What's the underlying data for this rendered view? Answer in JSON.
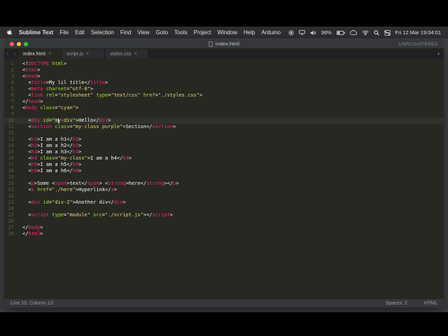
{
  "menubar": {
    "items": [
      "Sublime Text",
      "File",
      "Edit",
      "Selection",
      "Find",
      "View",
      "Goto",
      "Tools",
      "Project",
      "Window",
      "Help",
      "Arduino"
    ],
    "status_items": [
      {
        "type": "icon",
        "name": "screen-record-icon"
      },
      {
        "type": "icon",
        "name": "display-icon"
      },
      {
        "type": "icon",
        "name": "volume-icon"
      },
      {
        "type": "text",
        "name": "battery-percentage",
        "value": "36%"
      },
      {
        "type": "icon",
        "name": "battery-icon"
      },
      {
        "type": "icon",
        "name": "cloud-icon"
      },
      {
        "type": "icon",
        "name": "wifi-icon"
      },
      {
        "type": "icon",
        "name": "search-icon"
      },
      {
        "type": "icon",
        "name": "control-center-icon"
      },
      {
        "type": "text",
        "name": "menubar-clock",
        "value": "Fri 12 Mar 19:04:01"
      }
    ]
  },
  "window": {
    "title": "index.html",
    "registration_status": "UNREGISTERED",
    "tabs": [
      {
        "label": "index.html",
        "active": true
      },
      {
        "label": "script.js",
        "active": false
      },
      {
        "label": "styles.css",
        "active": false
      }
    ],
    "close_glyph": "×",
    "tab_scroll_left": "‹",
    "tab_scroll_right": "›",
    "tab_overflow_glyph": "▾"
  },
  "statusbar": {
    "position": "Line 10, Column 13",
    "indentation": "Spaces: 2",
    "syntax": "HTML"
  },
  "editor": {
    "current_line": 10,
    "caret_column": 13,
    "colors": {
      "tag": "#f92672",
      "attr": "#a6e22e",
      "string": "#e6db74",
      "text": "#f8f8f2",
      "punct": "#f8f8f2",
      "line_number": "#5b5d50",
      "background": "#272822"
    },
    "lines": [
      [
        [
          "w",
          "<!"
        ],
        [
          "t",
          "DOCTYPE"
        ],
        [
          "a",
          " html"
        ],
        [
          "w",
          ">"
        ]
      ],
      [
        [
          "w",
          "<"
        ],
        [
          "t",
          "html"
        ],
        [
          "w",
          ">"
        ]
      ],
      [
        [
          "w",
          "<"
        ],
        [
          "t",
          "head"
        ],
        [
          "w",
          ">"
        ]
      ],
      [
        [
          "w",
          "  <"
        ],
        [
          "t",
          "title"
        ],
        [
          "w",
          ">"
        ],
        [
          "x",
          "My lil title"
        ],
        [
          "w",
          "</"
        ],
        [
          "t",
          "title"
        ],
        [
          "w",
          ">"
        ]
      ],
      [
        [
          "w",
          "  <"
        ],
        [
          "t",
          "meta"
        ],
        [
          "a",
          " charset"
        ],
        [
          "w",
          "="
        ],
        [
          "s",
          "\"utf-8\""
        ],
        [
          "w",
          ">"
        ]
      ],
      [
        [
          "w",
          "  <"
        ],
        [
          "t",
          "link"
        ],
        [
          "a",
          " rel"
        ],
        [
          "w",
          "="
        ],
        [
          "s",
          "\"stylesheet\""
        ],
        [
          "a",
          " type"
        ],
        [
          "w",
          "="
        ],
        [
          "s",
          "\"text/css\""
        ],
        [
          "a",
          " href"
        ],
        [
          "w",
          "="
        ],
        [
          "s",
          "\"./styles.css\""
        ],
        [
          "w",
          ">"
        ]
      ],
      [
        [
          "w",
          "</"
        ],
        [
          "t",
          "head"
        ],
        [
          "w",
          ">"
        ]
      ],
      [
        [
          "w",
          "<"
        ],
        [
          "t",
          "body"
        ],
        [
          "a",
          " class"
        ],
        [
          "w",
          "="
        ],
        [
          "s",
          "\"cyan\""
        ],
        [
          "w",
          ">"
        ]
      ],
      [],
      [
        [
          "w",
          "  <"
        ],
        [
          "t",
          "div"
        ],
        [
          "a",
          " id"
        ],
        [
          "w",
          "="
        ],
        [
          "s",
          "\"my-div\""
        ],
        [
          "w",
          ">"
        ],
        [
          "x",
          "Hello"
        ],
        [
          "w",
          "</"
        ],
        [
          "t",
          "div"
        ],
        [
          "w",
          ">"
        ]
      ],
      [
        [
          "w",
          "  <"
        ],
        [
          "t",
          "section"
        ],
        [
          "a",
          " class"
        ],
        [
          "w",
          "="
        ],
        [
          "s",
          "\"my-class purple\""
        ],
        [
          "w",
          ">"
        ],
        [
          "x",
          "Section"
        ],
        [
          "w",
          "</"
        ],
        [
          "t",
          "section"
        ],
        [
          "w",
          ">"
        ]
      ],
      [],
      [
        [
          "w",
          "  <"
        ],
        [
          "t",
          "h1"
        ],
        [
          "w",
          ">"
        ],
        [
          "x",
          "I am a h1"
        ],
        [
          "w",
          "</"
        ],
        [
          "t",
          "h1"
        ],
        [
          "w",
          ">"
        ]
      ],
      [
        [
          "w",
          "  <"
        ],
        [
          "t",
          "h2"
        ],
        [
          "w",
          ">"
        ],
        [
          "x",
          "I am a h2"
        ],
        [
          "w",
          "</"
        ],
        [
          "t",
          "h2"
        ],
        [
          "w",
          ">"
        ]
      ],
      [
        [
          "w",
          "  <"
        ],
        [
          "t",
          "h3"
        ],
        [
          "w",
          ">"
        ],
        [
          "x",
          "I am a h3"
        ],
        [
          "w",
          "</"
        ],
        [
          "t",
          "h3"
        ],
        [
          "w",
          ">"
        ]
      ],
      [
        [
          "w",
          "  <"
        ],
        [
          "t",
          "h4"
        ],
        [
          "a",
          " class"
        ],
        [
          "w",
          "="
        ],
        [
          "s",
          "\"my-class\""
        ],
        [
          "w",
          ">"
        ],
        [
          "x",
          "I am a h4"
        ],
        [
          "w",
          "</"
        ],
        [
          "t",
          "h4"
        ],
        [
          "w",
          ">"
        ]
      ],
      [
        [
          "w",
          "  <"
        ],
        [
          "t",
          "h5"
        ],
        [
          "w",
          ">"
        ],
        [
          "x",
          "I am a h5"
        ],
        [
          "w",
          "</"
        ],
        [
          "t",
          "h5"
        ],
        [
          "w",
          ">"
        ]
      ],
      [
        [
          "w",
          "  <"
        ],
        [
          "t",
          "h6"
        ],
        [
          "w",
          ">"
        ],
        [
          "x",
          "I am a h6"
        ],
        [
          "w",
          "</"
        ],
        [
          "t",
          "h6"
        ],
        [
          "w",
          ">"
        ]
      ],
      [],
      [
        [
          "w",
          "  <"
        ],
        [
          "t",
          "p"
        ],
        [
          "w",
          ">"
        ],
        [
          "x",
          "Some "
        ],
        [
          "w",
          "<"
        ],
        [
          "t",
          "span"
        ],
        [
          "w",
          ">"
        ],
        [
          "x",
          "text"
        ],
        [
          "w",
          "</"
        ],
        [
          "t",
          "span"
        ],
        [
          "w",
          ">"
        ],
        [
          "x",
          " "
        ],
        [
          "w",
          "<"
        ],
        [
          "t",
          "strong"
        ],
        [
          "w",
          ">"
        ],
        [
          "x",
          "here"
        ],
        [
          "w",
          "</"
        ],
        [
          "t",
          "strong"
        ],
        [
          "w",
          ">"
        ],
        [
          "w",
          "</"
        ],
        [
          "t",
          "p"
        ],
        [
          "w",
          ">"
        ]
      ],
      [
        [
          "w",
          "  <"
        ],
        [
          "t",
          "a"
        ],
        [
          "a",
          " href"
        ],
        [
          "w",
          "="
        ],
        [
          "s",
          "\"./here\""
        ],
        [
          "w",
          ">"
        ],
        [
          "x",
          "Hyperlink"
        ],
        [
          "w",
          "</"
        ],
        [
          "t",
          "a"
        ],
        [
          "w",
          ">"
        ]
      ],
      [],
      [
        [
          "w",
          "  <"
        ],
        [
          "t",
          "div"
        ],
        [
          "a",
          " id"
        ],
        [
          "w",
          "="
        ],
        [
          "s",
          "\"div-2\""
        ],
        [
          "w",
          ">"
        ],
        [
          "x",
          "Another div"
        ],
        [
          "w",
          "</"
        ],
        [
          "t",
          "div"
        ],
        [
          "w",
          ">"
        ]
      ],
      [],
      [
        [
          "w",
          "  <"
        ],
        [
          "t",
          "script"
        ],
        [
          "a",
          " type"
        ],
        [
          "w",
          "="
        ],
        [
          "s",
          "\"module\""
        ],
        [
          "a",
          " src"
        ],
        [
          "w",
          "="
        ],
        [
          "s",
          "\"./script.js\""
        ],
        [
          "w",
          ">"
        ],
        [
          "w",
          "</"
        ],
        [
          "t",
          "script"
        ],
        [
          "w",
          ">"
        ]
      ],
      [],
      [
        [
          "w",
          "</"
        ],
        [
          "t",
          "body"
        ],
        [
          "w",
          ">"
        ]
      ],
      [
        [
          "w",
          "</"
        ],
        [
          "t",
          "html"
        ],
        [
          "w",
          ">"
        ]
      ]
    ]
  }
}
